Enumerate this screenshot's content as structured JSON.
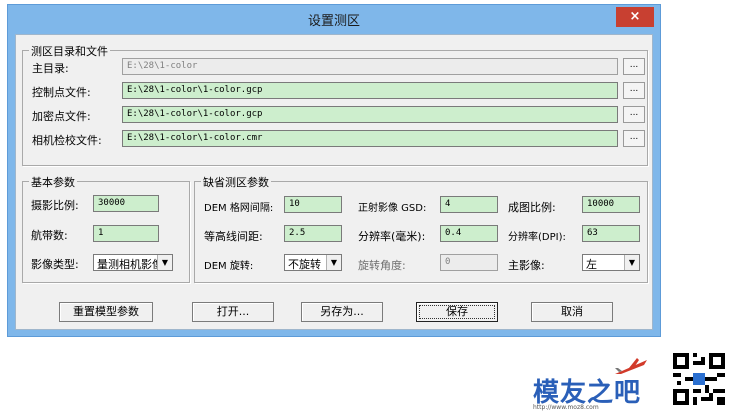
{
  "dialog": {
    "title": "设置测区",
    "close_label": "×"
  },
  "dir_group": {
    "legend": "测区目录和文件",
    "rows": [
      {
        "label": "主目录:",
        "value": "E:\\28\\1-color",
        "browse": "..."
      },
      {
        "label": "控制点文件:",
        "value": "E:\\28\\1-color\\1-color.gcp",
        "browse": "..."
      },
      {
        "label": "加密点文件:",
        "value": "E:\\28\\1-color\\1-color.gcp",
        "browse": "..."
      },
      {
        "label": "相机检校文件:",
        "value": "E:\\28\\1-color\\1-color.cmr",
        "browse": "..."
      }
    ]
  },
  "basic_group": {
    "legend": "基本参数",
    "scale_label": "摄影比例:",
    "scale_value": "30000",
    "strips_label": "航带数:",
    "strips_value": "1",
    "image_type_label": "影像类型:",
    "image_type_value": "量测相机影像"
  },
  "default_group": {
    "legend": "缺省测区参数",
    "dem_grid_label": "DEM 格网间隔:",
    "dem_grid_value": "10",
    "ortho_gsd_label": "正射影像 GSD:",
    "ortho_gsd_value": "4",
    "map_scale_label": "成图比例:",
    "map_scale_value": "10000",
    "contour_label": "等高线间距:",
    "contour_value": "2.5",
    "resolution_mm_label": "分辨率(毫米):",
    "resolution_mm_value": "0.4",
    "resolution_dpi_label": "分辨率(DPI):",
    "resolution_dpi_value": "63",
    "dem_rotate_label": "DEM 旋转:",
    "dem_rotate_value": "不旋转",
    "rotate_angle_label": "旋转角度:",
    "rotate_angle_value": "0",
    "main_image_label": "主影像:",
    "main_image_value": "左"
  },
  "buttons": {
    "reset": "重置模型参数",
    "open": "打开...",
    "save_as": "另存为...",
    "save": "保存",
    "cancel": "取消"
  },
  "watermark": {
    "logo_text": "模友之吧",
    "url": "http://www.moz8.com"
  },
  "colors": {
    "title_bar": "#7fb7ea",
    "close_button": "#c84031",
    "field_bg": "#cdeecd",
    "client_bg": "#f0f0f0"
  }
}
